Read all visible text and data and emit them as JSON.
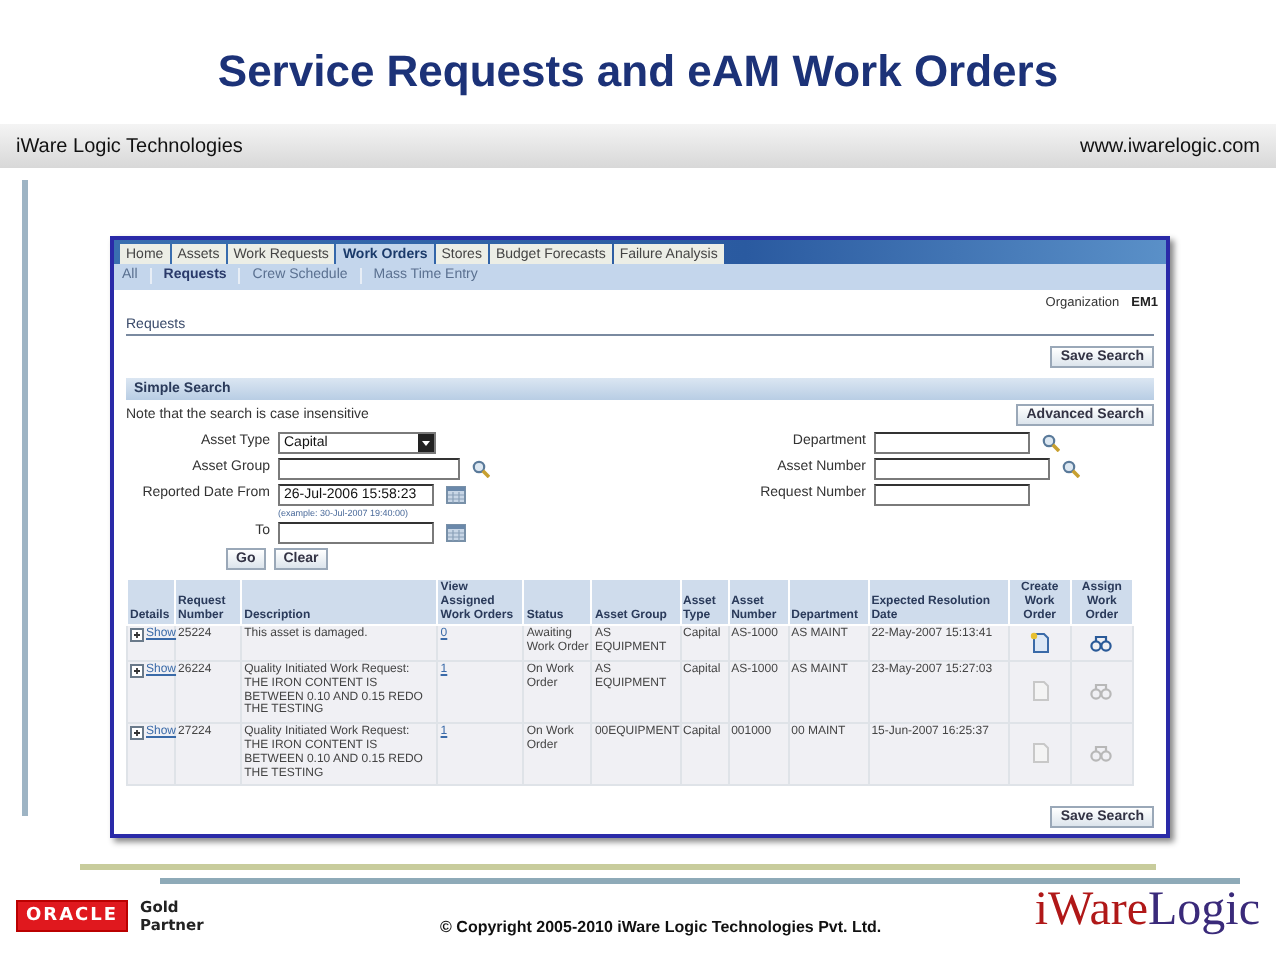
{
  "slide": {
    "title": "Service Requests and eAM Work Orders",
    "company": "iWare Logic Technologies",
    "website": "www.iwarelogic.com"
  },
  "app": {
    "tabs": [
      {
        "label": "Home",
        "selected": false
      },
      {
        "label": "Assets",
        "selected": false
      },
      {
        "label": "Work Requests",
        "selected": false
      },
      {
        "label": "Work Orders",
        "selected": true
      },
      {
        "label": "Stores",
        "selected": false
      },
      {
        "label": "Budget Forecasts",
        "selected": false
      },
      {
        "label": "Failure Analysis",
        "selected": false
      }
    ],
    "subtabs": [
      {
        "label": "All",
        "selected": false
      },
      {
        "label": "Requests",
        "selected": true
      },
      {
        "label": "Crew Schedule",
        "selected": false
      },
      {
        "label": "Mass Time Entry",
        "selected": false
      }
    ],
    "organization_label": "Organization",
    "organization_value": "EM1",
    "page_title": "Requests",
    "save_search": "Save Search",
    "section_title": "Simple Search",
    "note": "Note that the search is case insensitive",
    "advanced_search": "Advanced Search",
    "left_fields": [
      {
        "label": "Asset Type",
        "kind": "select",
        "value": "Capital"
      },
      {
        "label": "Asset Group",
        "kind": "lookup"
      },
      {
        "label": "Reported Date From",
        "kind": "date",
        "value": "26-Jul-2006 15:58:23",
        "hint": "(example: 30-Jul-2007 19:40:00)"
      },
      {
        "label": "To",
        "kind": "date"
      }
    ],
    "right_fields": [
      {
        "label": "Department",
        "kind": "lookup"
      },
      {
        "label": "Asset Number",
        "kind": "lookup"
      },
      {
        "label": "Request Number",
        "kind": "text"
      }
    ],
    "buttons": [
      "Go",
      "Clear"
    ],
    "columns": [
      "Details",
      "Request Number",
      "Description",
      "View Assigned Work Orders",
      "Status",
      "Asset Group",
      "Asset Type",
      "Asset Number",
      "Department",
      "Expected Resolution Date",
      "Create Work Order",
      "Assign Work Order"
    ],
    "rows": [
      {
        "details": "Show",
        "request_number": "25224",
        "description": "This asset is damaged.",
        "assigned_work_orders": "0",
        "status": "Awaiting Work Order",
        "asset_group": "AS EQUIPMENT",
        "asset_type": "Capital",
        "asset_number": "AS-1000",
        "department": "AS MAINT",
        "expected_resolution": "22-May-2007 15:13:41",
        "actions_enabled": true
      },
      {
        "details": "Show",
        "request_number": "26224",
        "description": "Quality Initiated Work Request: THE IRON CONTENT IS BETWEEN 0.10 AND 0.15 REDO THE TESTING",
        "assigned_work_orders": "1",
        "status": "On Work Order",
        "asset_group": "AS EQUIPMENT",
        "asset_type": "Capital",
        "asset_number": "AS-1000",
        "department": "AS MAINT",
        "expected_resolution": "23-May-2007 15:27:03",
        "actions_enabled": false
      },
      {
        "details": "Show",
        "request_number": "27224",
        "description": "Quality Initiated Work Request: THE IRON CONTENT IS BETWEEN 0.10 AND 0.15 REDO THE TESTING",
        "assigned_work_orders": "1",
        "status": "On Work Order",
        "asset_group": "00EQUIPMENT",
        "asset_type": "Capital",
        "asset_number": "001000",
        "department": "00 MAINT",
        "expected_resolution": "15-Jun-2007 16:25:37",
        "actions_enabled": false
      }
    ],
    "bottom_save_search": "Save Search"
  },
  "footer": {
    "partner_logo": "ORACLE",
    "partner_level": "Gold Partner",
    "copyright": "© Copyright 2005-2010 iWare Logic Technologies Pvt. Ltd.",
    "brand": [
      "iWare",
      "Logic"
    ]
  }
}
